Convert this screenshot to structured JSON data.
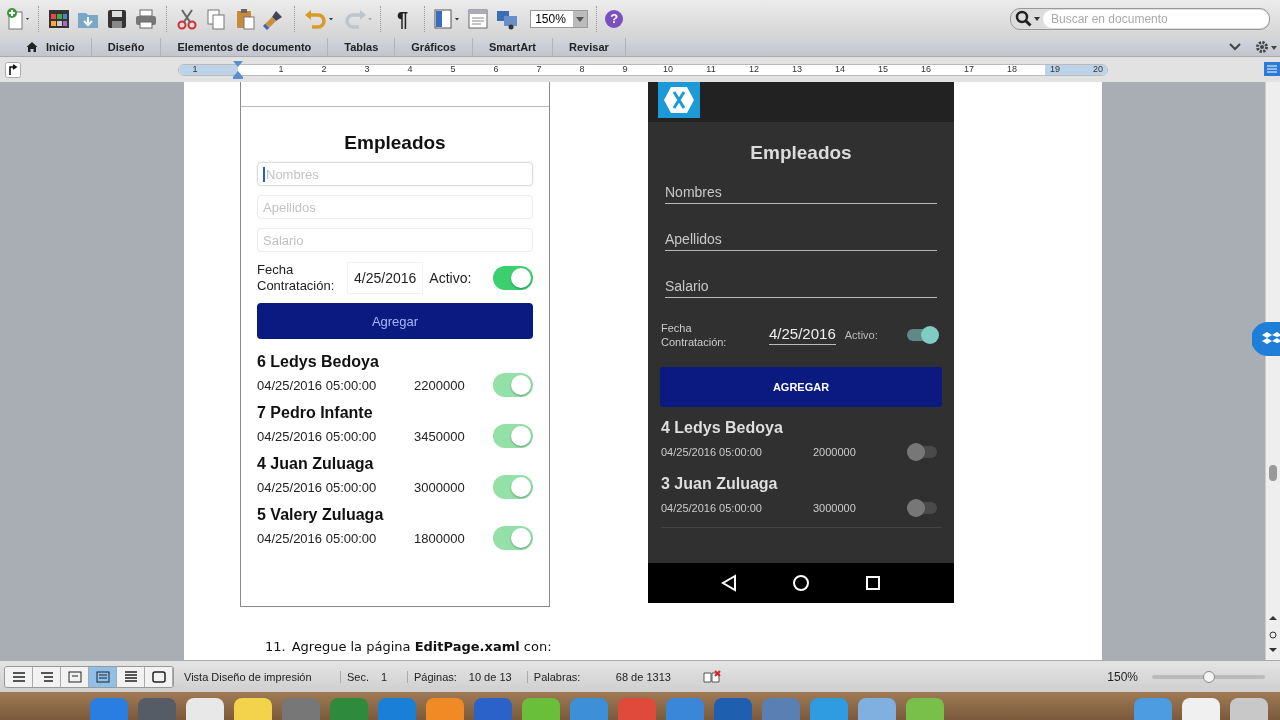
{
  "toolbar": {
    "pilcrow": "¶",
    "zoom": "150%",
    "help": "?",
    "search": {
      "placeholder": "Buscar en documento"
    }
  },
  "ribbon_tabs": [
    {
      "label": "Inicio",
      "selected": false,
      "kind": "home"
    },
    {
      "label": "Diseño",
      "selected": false
    },
    {
      "label": "Elementos de documento",
      "selected": false
    },
    {
      "label": "Tablas",
      "selected": false
    },
    {
      "label": "Gráficos",
      "selected": false
    },
    {
      "label": "SmartArt",
      "selected": false
    },
    {
      "label": "Revisar",
      "selected": false
    }
  ],
  "ruler": {
    "labels": [
      "1",
      "1",
      "2",
      "3",
      "4",
      "5",
      "6",
      "7",
      "8",
      "9",
      "10",
      "11",
      "12",
      "13",
      "14",
      "15",
      "16",
      "17",
      "18",
      "19",
      "20"
    ]
  },
  "ios_screenshot": {
    "title": "Empleados",
    "fields": [
      {
        "placeholder": "Nombres",
        "focused": true
      },
      {
        "placeholder": "Apellidos",
        "focused": false
      },
      {
        "placeholder": "Salario",
        "focused": false
      }
    ],
    "date_label": "Fecha Contratación:",
    "date": "4/25/2016",
    "active_label": "Activo:",
    "active": true,
    "button": "Agregar",
    "employees": [
      {
        "name": "6 Ledys Bedoya",
        "date": "04/25/2016 05:00:00",
        "salary": "2200000",
        "active": true
      },
      {
        "name": "7 Pedro Infante",
        "date": "04/25/2016 05:00:00",
        "salary": "3450000",
        "active": true
      },
      {
        "name": "4 Juan Zuluaga",
        "date": "04/25/2016 05:00:00",
        "salary": "3000000",
        "active": true
      },
      {
        "name": "5 Valery Zuluaga",
        "date": "04/25/2016 05:00:00",
        "salary": "1800000",
        "active": true
      }
    ]
  },
  "android_screenshot": {
    "title": "Empleados",
    "fields": [
      {
        "placeholder": "Nombres"
      },
      {
        "placeholder": "Apellidos"
      },
      {
        "placeholder": "Salario"
      }
    ],
    "date_label": "Fecha Contratación:",
    "date": "4/25/2016",
    "active_label": "Activo:",
    "active": true,
    "button": "AGREGAR",
    "employees": [
      {
        "name": "4 Ledys Bedoya",
        "date": "04/25/2016 05:00:00",
        "salary": "2000000",
        "active": false
      },
      {
        "name": "3 Juan Zuluaga",
        "date": "04/25/2016 05:00:00",
        "salary": "3000000",
        "active": false
      }
    ]
  },
  "paragraph": {
    "number": "11.",
    "text": "Agregue la página **EditPage.xaml** con:"
  },
  "status_bar": {
    "views": [
      {
        "selected": false
      },
      {
        "selected": false
      },
      {
        "selected": false
      },
      {
        "selected": true
      },
      {
        "selected": false
      },
      {
        "selected": false
      }
    ],
    "view_name": "Vista Diseño de impresión",
    "section_label": "Sec.",
    "section": "1",
    "pages_label": "Páginas:",
    "pages": "10 de 13",
    "words_label": "Palabras:",
    "words": "68 de 1313",
    "zoom": "150%",
    "zoom_slider": {
      "level": 0.5
    }
  }
}
